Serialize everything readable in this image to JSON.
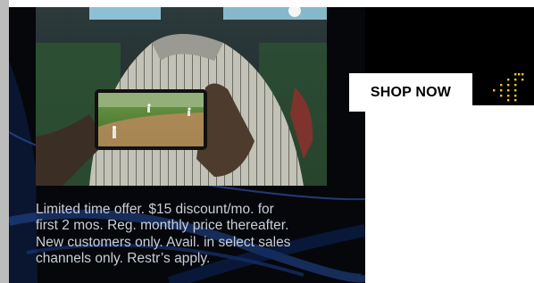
{
  "ad": {
    "cta_label": "SHOP NOW",
    "disclaimer_lines": [
      "Limited time offer. $15 discount/mo. for",
      "first 2 mos. Reg. monthly price thereafter.",
      "New customers only. Avail. in select sales",
      "channels only. Restr’s apply."
    ]
  },
  "colors": {
    "panel": "#05070b",
    "accent_yellow": "#f2c21b",
    "disclaimer_text": "#c9ced8",
    "cta_background": "#ffffff"
  },
  "icons": [
    "decorative-dots-icon",
    "sports-photo"
  ]
}
